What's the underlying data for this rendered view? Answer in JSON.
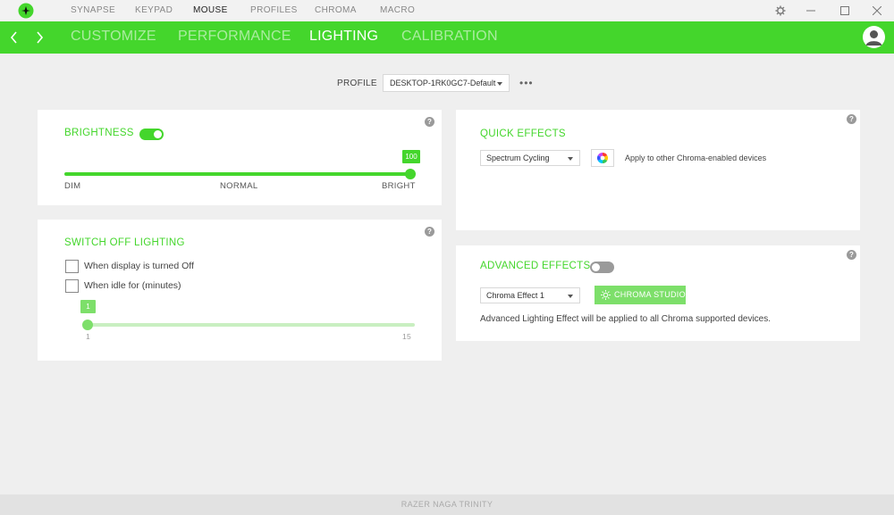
{
  "top_nav": {
    "items": [
      {
        "label": "SYNAPSE",
        "active": false
      },
      {
        "label": "KEYPAD",
        "active": false
      },
      {
        "label": "MOUSE",
        "active": true
      },
      {
        "label": "PROFILES",
        "active": false
      },
      {
        "label": "CHROMA",
        "active": false
      },
      {
        "label": "MACRO",
        "active": false
      }
    ]
  },
  "sub_nav": {
    "tabs": [
      {
        "label": "CUSTOMIZE",
        "active": false
      },
      {
        "label": "PERFORMANCE",
        "active": false
      },
      {
        "label": "LIGHTING",
        "active": true
      },
      {
        "label": "CALIBRATION",
        "active": false
      }
    ]
  },
  "profile": {
    "label": "PROFILE",
    "value": "DESKTOP-1RK0GC7-Default",
    "more": "•••"
  },
  "brightness": {
    "title": "BRIGHTNESS",
    "enabled": true,
    "value": "100",
    "level_percent": 100,
    "labels": {
      "min": "DIM",
      "mid": "NORMAL",
      "max": "BRIGHT"
    }
  },
  "switch_off": {
    "title": "SWITCH OFF LIGHTING",
    "option_display": "When display is turned Off",
    "option_idle": "When idle for (minutes)",
    "idle_value": "1",
    "idle_min": "1",
    "idle_max": "15"
  },
  "quick_effects": {
    "title": "QUICK EFFECTS",
    "selected": "Spectrum Cycling",
    "apply_text": "Apply to other Chroma-enabled devices"
  },
  "advanced_effects": {
    "title": "ADVANCED EFFECTS",
    "enabled": false,
    "selected": "Chroma Effect 1",
    "studio_label": "CHROMA STUDIO",
    "info": "Advanced Lighting Effect will be applied to all Chroma supported devices."
  },
  "help_symbol": "?",
  "footer": {
    "device_name": "RAZER NAGA TRINITY"
  },
  "colors": {
    "accent": "#44d62c",
    "accent_light": "#7ddf6a",
    "track_light": "#c9efc1"
  }
}
